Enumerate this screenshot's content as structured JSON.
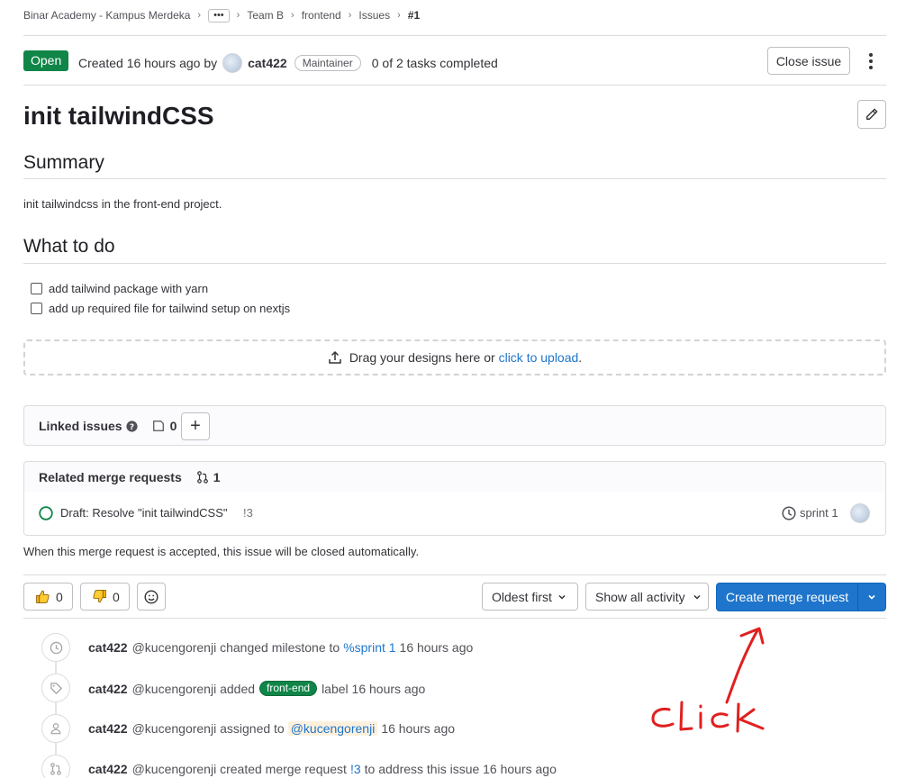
{
  "breadcrumb": {
    "group": "Binar Academy - Kampus Merdeka",
    "more": "•••",
    "team": "Team B",
    "project": "frontend",
    "section": "Issues",
    "current": "#1"
  },
  "issue_header": {
    "status": "Open",
    "created_text": "Created 16 hours ago by",
    "author": "cat422",
    "role": "Maintainer",
    "tasks": "0 of 2 tasks completed",
    "close_button": "Close issue"
  },
  "issue": {
    "title": "init tailwindCSS",
    "summary_heading": "Summary",
    "summary_text": "init tailwindcss in the front-end project.",
    "todo_heading": "What to do",
    "tasks": [
      {
        "label": "add tailwind package with yarn",
        "checked": false
      },
      {
        "label": "add up required file for tailwind setup on nextjs",
        "checked": false
      }
    ]
  },
  "upload": {
    "text": "Drag your designs here or",
    "link": "click to upload",
    "period": "."
  },
  "linked_issues": {
    "label": "Linked issues",
    "count": "0",
    "add_button": "+"
  },
  "related_mrs": {
    "label": "Related merge requests",
    "count": "1",
    "item_title": "Draft: Resolve \"init tailwindCSS\"",
    "item_ref": "!3",
    "milestone": "sprint 1"
  },
  "auto_close_text": "When this merge request is accepted, this issue will be closed automatically.",
  "actions": {
    "thumbs_up_count": "0",
    "thumbs_down_count": "0",
    "sort": "Oldest first",
    "filter": "Show all activity",
    "create_mr": "Create merge request"
  },
  "activity": [
    {
      "icon": "clock-icon",
      "user": "cat422",
      "handle": "@kucengorenji",
      "pre": "changed milestone to",
      "link": "%sprint 1",
      "post": "16 hours ago"
    },
    {
      "icon": "tag-icon",
      "user": "cat422",
      "handle": "@kucengorenji",
      "pre": "added",
      "label": "front-end",
      "post": "label 16 hours ago"
    },
    {
      "icon": "user-icon",
      "user": "cat422",
      "handle": "@kucengorenji",
      "pre": "assigned to",
      "mention": "@kucengorenji",
      "post": "16 hours ago"
    },
    {
      "icon": "merge-request-icon",
      "user": "cat422",
      "handle": "@kucengorenji",
      "pre": "created merge request",
      "link": "!3",
      "post": "to address this issue 16 hours ago"
    }
  ],
  "annotation": {
    "text": "click",
    "color": "#e02020"
  },
  "colors": {
    "open_badge": "#108548",
    "primary_button": "#1f75cb",
    "link": "#1f75cb"
  }
}
